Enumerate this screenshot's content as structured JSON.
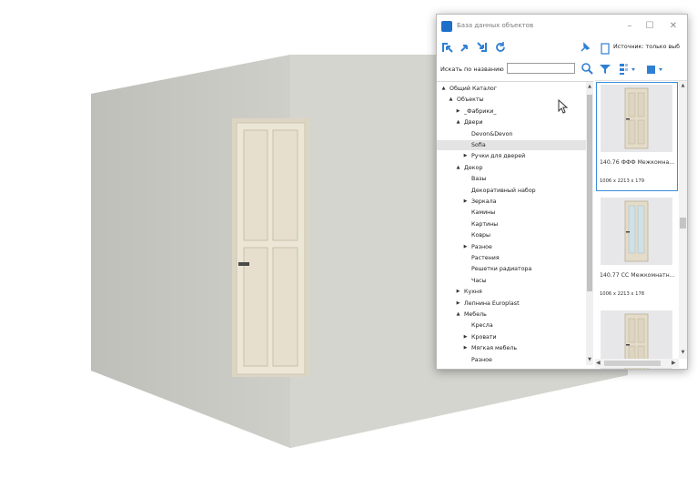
{
  "window": {
    "title": "База данных объектов",
    "minimize_icon": "minimize-icon",
    "maximize_icon": "maximize-icon",
    "close_icon": "close-icon"
  },
  "toolbar": {
    "icons": [
      "expand-all-icon",
      "collapse-icon",
      "collapse-all-icon",
      "refresh-icon",
      "pin-icon"
    ]
  },
  "search": {
    "label": "Искать по названию",
    "value": "",
    "placeholder": "",
    "icon": "search-icon"
  },
  "tree": {
    "items": [
      {
        "label": "Общий Каталог",
        "arrow": "▲"
      },
      {
        "label": "Объекты",
        "arrow": "▲"
      },
      {
        "label": "_Фабрики_",
        "arrow": "▶"
      },
      {
        "label": "Двери",
        "arrow": "▲"
      },
      {
        "label": "Devon&Devon",
        "arrow": ""
      },
      {
        "label": "Sofia",
        "arrow": "",
        "selected": true
      },
      {
        "label": "Ручки для дверей",
        "arrow": "▶"
      },
      {
        "label": "Декор",
        "arrow": "▲"
      },
      {
        "label": "Вазы",
        "arrow": ""
      },
      {
        "label": "Декоративный набор",
        "arrow": ""
      },
      {
        "label": "Зеркала",
        "arrow": "▶"
      },
      {
        "label": "Камины",
        "arrow": ""
      },
      {
        "label": "Картины",
        "arrow": ""
      },
      {
        "label": "Ковры",
        "arrow": ""
      },
      {
        "label": "Разное",
        "arrow": "▶"
      },
      {
        "label": "Растения",
        "arrow": ""
      },
      {
        "label": "Решетки радиатора",
        "arrow": ""
      },
      {
        "label": "Часы",
        "arrow": ""
      },
      {
        "label": "Кухня",
        "arrow": "▶"
      },
      {
        "label": "Лепнина Europlast",
        "arrow": "▶"
      },
      {
        "label": "Мебель",
        "arrow": "▲"
      },
      {
        "label": "Кресла",
        "arrow": ""
      },
      {
        "label": "Кровати",
        "arrow": "▶"
      },
      {
        "label": "Мягкая мебель",
        "arrow": "▶"
      },
      {
        "label": "Разное",
        "arrow": ""
      }
    ]
  },
  "preview": {
    "source_label": "Источник: только выб",
    "toolbar_icons": [
      "page-icon",
      "filter-icon",
      "sort-icon",
      "view-mode-icon"
    ],
    "cards": [
      {
        "title": "140.76 ФФФ Межкомна...",
        "size": "1006 x 2213 x 179",
        "selected": true
      },
      {
        "title": "140.77 СС Межкомнатн...",
        "size": "1006 x 2213 x 178",
        "selected": false
      },
      {
        "title": "",
        "size": "",
        "selected": false
      }
    ]
  },
  "colors": {
    "accent": "#1e6fc9",
    "toolbar_icon": "#2f7fd3",
    "selection": "#e4e4e4",
    "wall": "#d6d6d1",
    "floor": "#cbcbc6",
    "door": "#e9e3d4"
  }
}
